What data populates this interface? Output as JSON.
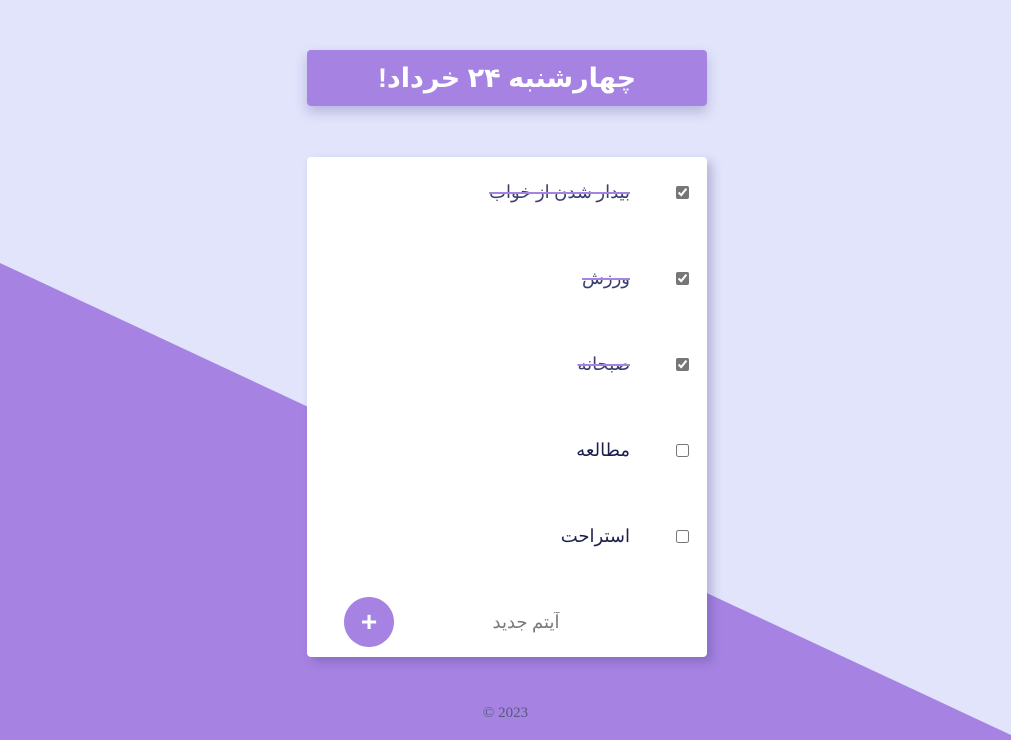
{
  "colors": {
    "background": "#e1e4fb",
    "accent": "#a683e3",
    "card": "#ffffff",
    "text": "#1b1f4d"
  },
  "header": {
    "title": "چهارشنبه ۲۴ خرداد!"
  },
  "todo": {
    "items": [
      {
        "label": "بیدار شدن از خواب",
        "checked": true
      },
      {
        "label": "ورزش",
        "checked": true
      },
      {
        "label": "صبحانه",
        "checked": true
      },
      {
        "label": "مطالعه",
        "checked": false
      },
      {
        "label": "استراحت",
        "checked": false
      }
    ],
    "new_item": {
      "placeholder": "آیتم جدید",
      "value": "",
      "add_label": "+",
      "add_icon": "plus-icon"
    }
  },
  "footer": {
    "text": "© 2023"
  }
}
